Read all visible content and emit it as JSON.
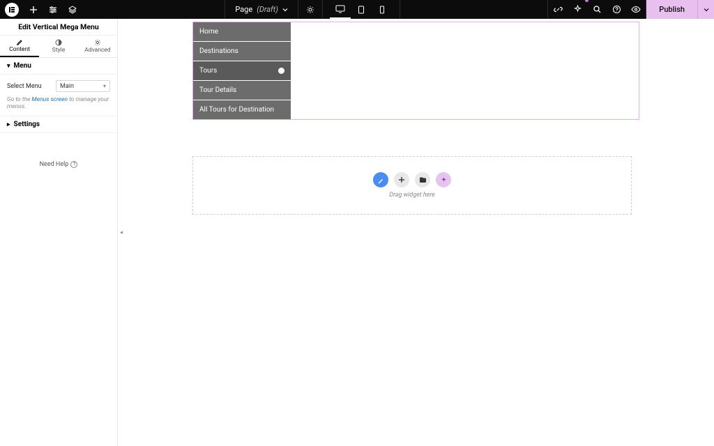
{
  "topbar": {
    "page_label": "Page",
    "page_status": "(Draft)",
    "publish": "Publish"
  },
  "panel": {
    "title": "Edit Vertical Mega Menu",
    "tabs": {
      "content": "Content",
      "style": "Style",
      "advanced": "Advanced"
    },
    "sections": {
      "menu": "Menu",
      "settings": "Settings"
    },
    "select_menu_label": "Select Menu",
    "select_menu_value": "Main",
    "helper_pre": "Go to the ",
    "helper_link": "Menus screen",
    "helper_post": " to manage your menus.",
    "need_help": "Need Help"
  },
  "menu_items": [
    "Home",
    "Destinations",
    "Tours",
    "Tour Details",
    "All Tours for Destination"
  ],
  "dropzone": {
    "hint": "Drag widget here"
  }
}
